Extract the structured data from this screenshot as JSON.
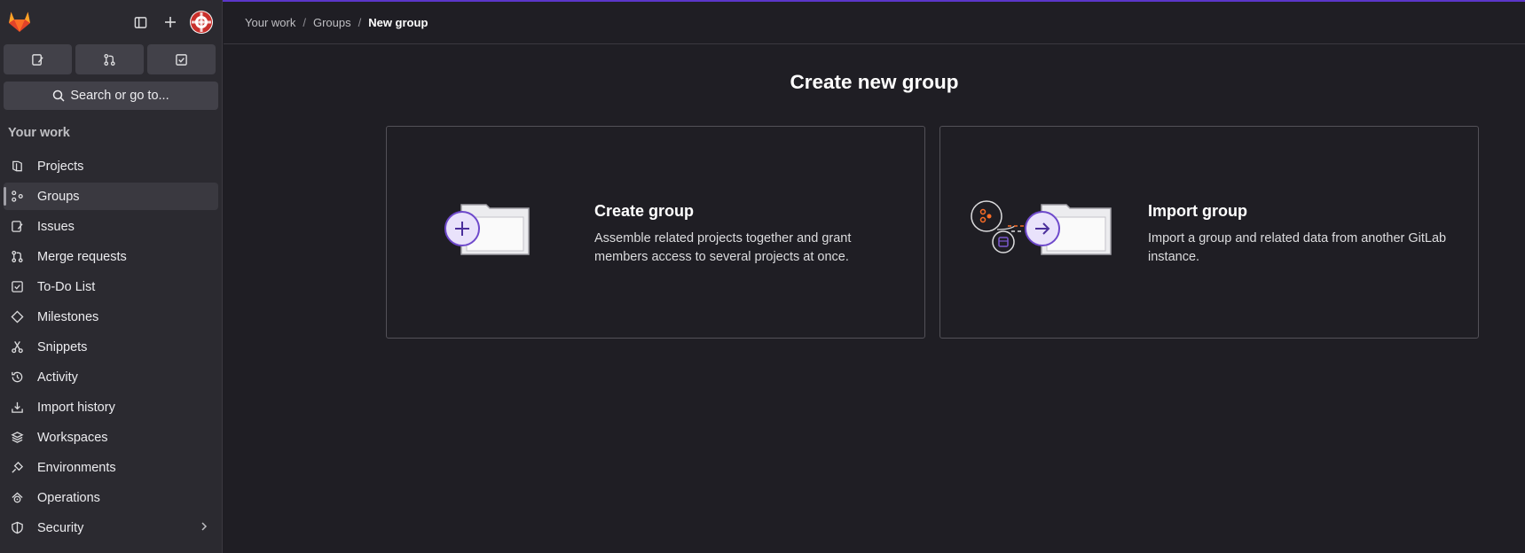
{
  "sidebar": {
    "search_label": "Search or go to...",
    "section_title": "Your work",
    "items": [
      {
        "label": "Projects",
        "icon": "project-icon"
      },
      {
        "label": "Groups",
        "icon": "group-icon",
        "active": true
      },
      {
        "label": "Issues",
        "icon": "issues-icon"
      },
      {
        "label": "Merge requests",
        "icon": "merge-request-icon"
      },
      {
        "label": "To-Do List",
        "icon": "todo-icon"
      },
      {
        "label": "Milestones",
        "icon": "milestone-icon"
      },
      {
        "label": "Snippets",
        "icon": "snippet-icon"
      },
      {
        "label": "Activity",
        "icon": "history-icon"
      },
      {
        "label": "Import history",
        "icon": "import-icon"
      },
      {
        "label": "Workspaces",
        "icon": "workspace-icon"
      },
      {
        "label": "Environments",
        "icon": "environment-icon"
      },
      {
        "label": "Operations",
        "icon": "operations-icon"
      },
      {
        "label": "Security",
        "icon": "shield-icon"
      }
    ]
  },
  "breadcrumb": {
    "items": [
      "Your work",
      "Groups",
      "New group"
    ]
  },
  "main": {
    "title": "Create new group",
    "cards": [
      {
        "title": "Create group",
        "description": "Assemble related projects together and grant members access to several projects at once."
      },
      {
        "title": "Import group",
        "description": "Import a group and related data from another GitLab instance."
      }
    ]
  },
  "colors": {
    "background": "#1f1e24",
    "sidebar": "#2b2a30",
    "accent": "#5b36c9",
    "brand_orange": "#fc6d26"
  }
}
